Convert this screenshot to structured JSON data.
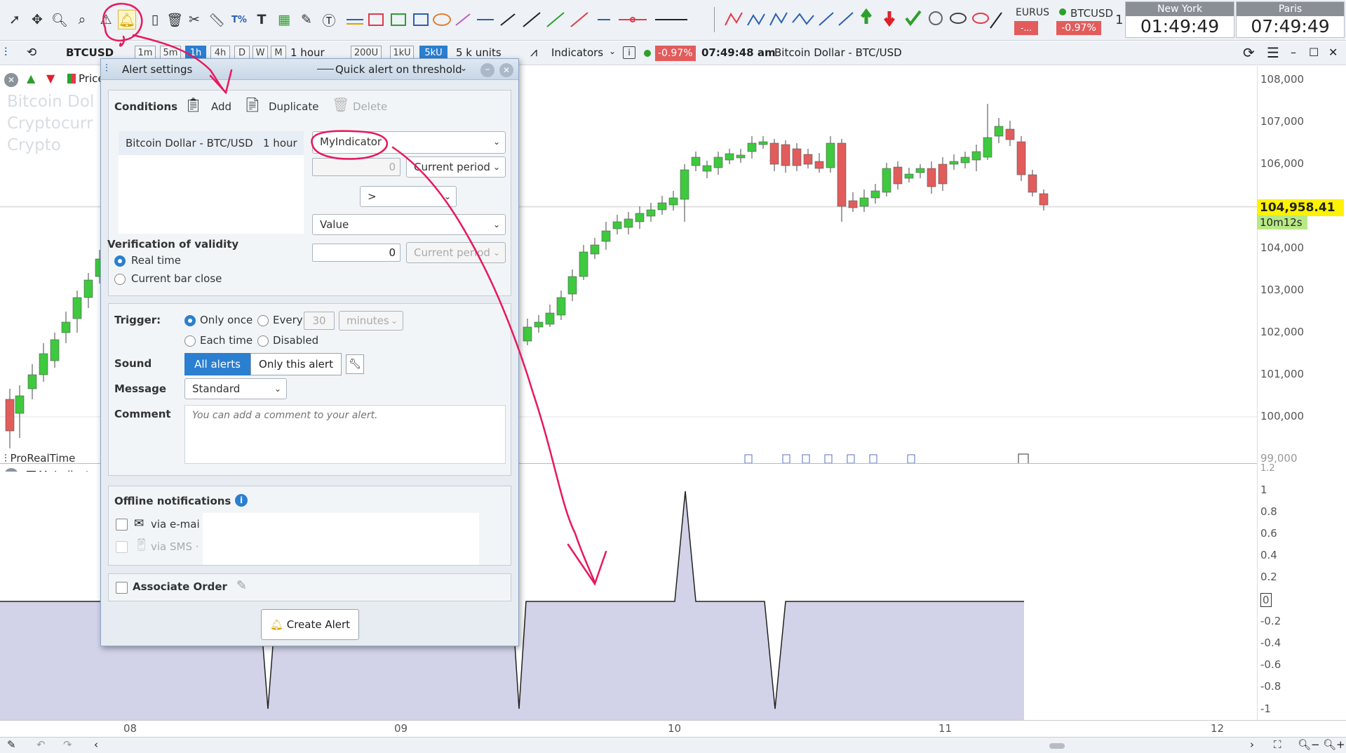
{
  "toolbar": {
    "ticker_eurusd": "EURUS",
    "ticker_btcusd": "BTCUSD",
    "btc_change": "-0.97%",
    "eurusd_change": "-...",
    "ticker_count": "1",
    "clocks": [
      {
        "city": "New York",
        "time": "01:49:49 am"
      },
      {
        "city": "Paris",
        "time": "07:49:49 am"
      }
    ]
  },
  "chart_header": {
    "symbol": "BTCUSD",
    "timeframes": [
      "1m",
      "5m",
      "1h",
      "4h",
      "D",
      "W",
      "M"
    ],
    "active_timeframe": "1h",
    "period": "1 hour",
    "units_buttons": [
      "200U",
      "1kU",
      "5kU"
    ],
    "units_active": "5kU",
    "units": "5 k units",
    "indicators": "Indicators",
    "change": "-0.97%",
    "time": "07:49:48 am",
    "instrument": "Bitcoin Dollar - BTC/USD"
  },
  "chart_panel": {
    "price_label": "Price",
    "watermark": [
      "Bitcoin Dol",
      "Cryptocurr",
      "Crypto"
    ],
    "brand": "ProRealTime",
    "indicator_label": "MyIndicator",
    "last_price": "104,958.41",
    "countdown": "10m12s",
    "y_ticks": [
      "108,000",
      "107,000",
      "106,000",
      "105,000",
      "104,000",
      "103,000",
      "102,000",
      "101,000",
      "100,000",
      "99,000"
    ],
    "osc_ticks": [
      "1.2",
      "1",
      "0.8",
      "0.6",
      "0.4",
      "0.2",
      "0",
      "-0.2",
      "-0.4",
      "-0.6",
      "-0.8",
      "-1"
    ],
    "x_ticks": [
      "08",
      "09",
      "10",
      "11",
      "12"
    ]
  },
  "dialog": {
    "title": "Alert settings",
    "mode": "Quick alert on threshold",
    "conditions_label": "Conditions",
    "add": "Add",
    "duplicate": "Duplicate",
    "delete": "Delete",
    "condition_instrument": "Bitcoin Dollar - BTC/USD",
    "condition_period": "1 hour",
    "indicator_select": "MyIndicator",
    "period_offset": "0",
    "period_select": "Current period",
    "operator": ">",
    "value_select": "Value",
    "value_input": "0",
    "period_select2": "Current period",
    "validity_label": "Verification of validity",
    "validity_realtime": "Real time",
    "validity_barclose": "Current bar close",
    "trigger_label": "Trigger:",
    "trigger_once": "Only once",
    "trigger_every": "Every",
    "trigger_every_value": "30",
    "trigger_every_unit": "minutes",
    "trigger_each": "Each time",
    "trigger_disabled": "Disabled",
    "sound_label": "Sound",
    "sound_all": "All alerts",
    "sound_this": "Only this alert",
    "message_label": "Message",
    "message_value": "Standard",
    "comment_label": "Comment",
    "comment_placeholder": "You can add a comment to your alert.",
    "offline_label": "Offline notifications",
    "via_email": "via e-mai",
    "via_sms": "via SMS ·",
    "associate_order": "Associate Order",
    "create_alert": "Create Alert"
  },
  "chart_data": {
    "type": "candlestick",
    "series": [
      {
        "name": "MyIndicator",
        "type": "line"
      }
    ],
    "ylim": [
      99000,
      108000
    ],
    "osc_ylim": [
      -1,
      1.2
    ]
  },
  "colors": {
    "up": "#3ec93e",
    "down": "#e25c5c",
    "accent": "#2b7fd0",
    "annotation": "#e8185c"
  }
}
